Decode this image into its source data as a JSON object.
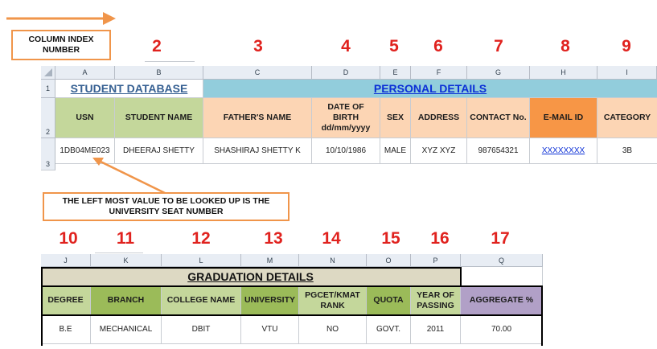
{
  "column_index_label": "COLUMN INDEX NUMBER",
  "callout_text": "THE LEFT MOST VALUE TO BE LOOKED UP IS THE UNIVERSITY SEAT NUMBER",
  "top_table": {
    "column_numbers": [
      "2",
      "3",
      "4",
      "5",
      "6",
      "7",
      "8",
      "9"
    ],
    "column_letters": [
      "A",
      "B",
      "C",
      "D",
      "E",
      "F",
      "G",
      "H",
      "I"
    ],
    "row_numbers": [
      "1",
      "2",
      "3"
    ],
    "student_database_title": "STUDENT DATABASE",
    "personal_details_title": "PERSONAL DETAILS",
    "headers": [
      "USN",
      "STUDENT NAME",
      "FATHER'S NAME",
      "DATE OF BIRTH dd/mm/yyyy",
      "SEX",
      "ADDRESS",
      "CONTACT No.",
      "E-MAIL ID",
      "CATEGORY"
    ],
    "row3": [
      "1DB04ME023",
      "DHEERAJ SHETTY",
      "SHASHIRAJ SHETTY K",
      "10/10/1986",
      "MALE",
      "XYZ XYZ",
      "987654321",
      "XXXXXXXX",
      "3B"
    ]
  },
  "bottom_table": {
    "column_numbers": [
      "10",
      "11",
      "12",
      "13",
      "14",
      "15",
      "16",
      "17"
    ],
    "column_letters": [
      "J",
      "K",
      "L",
      "M",
      "N",
      "O",
      "P",
      "Q"
    ],
    "graduation_title": "GRADUATION DETAILS",
    "headers": [
      "DEGREE",
      "BRANCH",
      "COLLEGE NAME",
      "UNIVERSITY",
      "PGCET/KMAT RANK",
      "QUOTA",
      "YEAR OF PASSING",
      "AGGREGATE %"
    ],
    "row": [
      "B.E",
      "MECHANICAL",
      "DBIT",
      "VTU",
      "NO",
      "GOVT.",
      "2011",
      "70.00"
    ]
  },
  "colors": {
    "usn_header": "#c4d79b",
    "student_name_header": "#c4d79b",
    "personal_header": "#fcd5b4",
    "email_header": "#f79646",
    "category_header": "#fcd5b4",
    "personal_title_bg": "#92cddc",
    "graduation_title_bg": "#ddd9c3",
    "grad_header_green": "#c4d79b",
    "grad_branch_green": "#9bbb59",
    "aggregate_header": "#b1a0c7",
    "numbers_red": "#e0221e",
    "callout_orange": "#f0954a"
  }
}
